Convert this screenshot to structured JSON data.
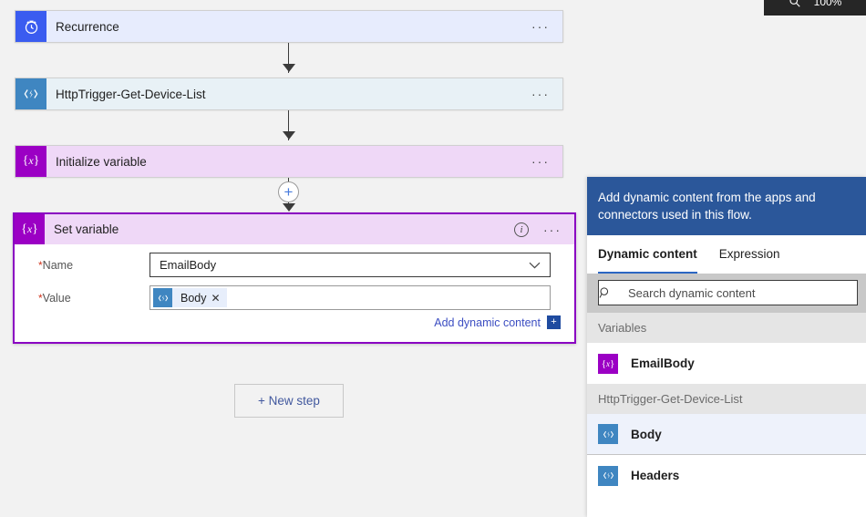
{
  "canvas": {
    "steps": [
      {
        "id": "recurrence",
        "title": "Recurrence",
        "icon": "clock-icon",
        "menu": "···"
      },
      {
        "id": "http-trigger",
        "title": "HttpTrigger-Get-Device-List",
        "icon": "azure-function-icon",
        "menu": "···"
      },
      {
        "id": "initialize-variable",
        "title": "Initialize variable",
        "icon": "variable-icon",
        "menu": "···"
      }
    ],
    "insert_node_label": "+",
    "new_step_label": "+ New step"
  },
  "set_variable": {
    "title": "Set variable",
    "icon": "variable-icon",
    "info_glyph": "i",
    "menu": "···",
    "required_mark": "*",
    "name_label": "Name",
    "name_value": "EmailBody",
    "name_chevron": "⌄",
    "value_label": "Value",
    "value_token": {
      "label": "Body",
      "icon": "azure-function-icon",
      "remove_glyph": "✕"
    },
    "add_dynamic_content_label": "Add dynamic content",
    "add_dynamic_content_plus": "+"
  },
  "dynamic_panel": {
    "banner": "Add dynamic content from the apps and connectors used in this flow.",
    "tabs": [
      {
        "label": "Dynamic content",
        "active": true
      },
      {
        "label": "Expression",
        "active": false
      }
    ],
    "search_placeholder": "Search dynamic content",
    "search_value": "",
    "search_icon": "search-icon",
    "groups": [
      {
        "header": "Variables",
        "items": [
          {
            "label": "EmailBody",
            "icon": "variable-icon",
            "icon_color": "purple",
            "highlighted": false
          }
        ]
      },
      {
        "header": "HttpTrigger-Get-Device-List",
        "items": [
          {
            "label": "Body",
            "icon": "azure-function-icon",
            "icon_color": "blue",
            "highlighted": true
          },
          {
            "label": "Headers",
            "icon": "azure-function-icon",
            "icon_color": "blue",
            "highlighted": false
          }
        ]
      }
    ]
  },
  "zoom_chip": {
    "icon": "magnifier-icon",
    "level": "100%"
  },
  "colors": {
    "accent_purple": "#8a00c2",
    "variable_icon": "#9b00c4",
    "function_icon": "#3f86c1",
    "recurrence_icon": "#3a5cf0",
    "banner_blue": "#2b579a",
    "link_blue": "#3c4ec2",
    "required_red": "#d0341c"
  }
}
